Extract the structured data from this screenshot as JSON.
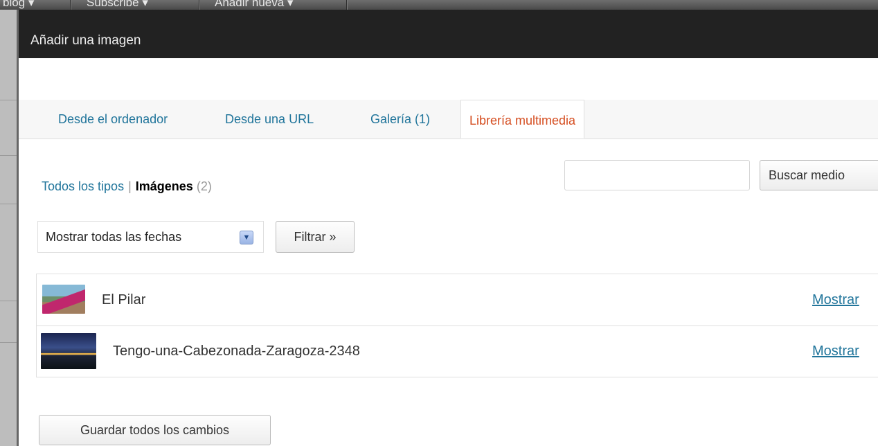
{
  "admin_bar": {
    "items": [
      {
        "label": "blog ▾"
      },
      {
        "label": "Subscribe ▾"
      },
      {
        "label": "Añadir nueva ▾"
      }
    ]
  },
  "modal": {
    "title": "Añadir una imagen",
    "tabs": [
      {
        "label": "Desde el ordenador",
        "active": false
      },
      {
        "label": "Desde una URL",
        "active": false
      },
      {
        "label": "Galería (1)",
        "active": false
      },
      {
        "label": "Librería multimedia",
        "active": true
      }
    ],
    "filters": {
      "all_types": "Todos los tipos",
      "separator": "|",
      "images": "Imágenes",
      "images_count": "(2)"
    },
    "search": {
      "value": "",
      "button_label": "Buscar medio"
    },
    "date_filter": {
      "selected": "Mostrar todas las fechas",
      "button_label": "Filtrar »"
    },
    "media_items": [
      {
        "title": "El Pilar",
        "action": "Mostrar",
        "thumbnail": "photo-woman-river"
      },
      {
        "title": "Tengo-una-Cabezonada-Zaragoza-2348",
        "action": "Mostrar",
        "thumbnail": "photo-night-city"
      }
    ],
    "save_all_label": "Guardar todos los cambios"
  },
  "colors": {
    "link": "#21759b",
    "active_tab": "#d54e21",
    "header_bg": "#222222",
    "page_bg": "#e7d27a"
  }
}
